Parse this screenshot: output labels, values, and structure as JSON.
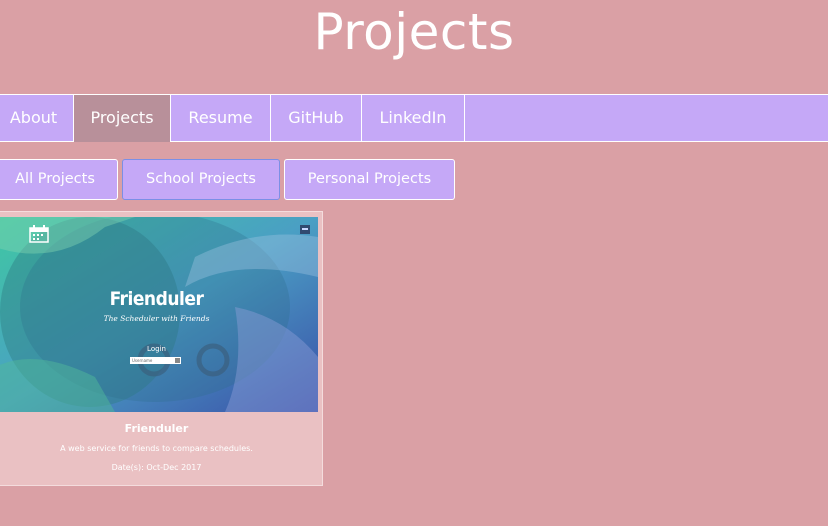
{
  "page": {
    "title": "Projects"
  },
  "nav": {
    "items": [
      {
        "label": "About",
        "active": false
      },
      {
        "label": "Projects",
        "active": true
      },
      {
        "label": "Resume",
        "active": false
      },
      {
        "label": "GitHub",
        "active": false
      },
      {
        "label": "LinkedIn",
        "active": false
      }
    ]
  },
  "filters": {
    "items": [
      {
        "label": "All Projects"
      },
      {
        "label": "School Projects"
      },
      {
        "label": "Personal Projects"
      }
    ],
    "selected": "School Projects"
  },
  "projects": [
    {
      "title": "Frienduler",
      "description": "A web service for friends to compare schedules.",
      "date": "Date(s): Oct-Dec 2017",
      "screenshot": {
        "heading": "Frienduler",
        "tagline": "The Scheduler with Friends",
        "login_label": "Login",
        "login_placeholder": "Username",
        "logo_icon": "calendar-icon"
      }
    }
  ],
  "colors": {
    "background": "#daa0a5",
    "nav_bg": "#c5a8f7",
    "nav_active": "#b8909a",
    "card_bg": "#eac1c3",
    "text": "#ffffff"
  }
}
